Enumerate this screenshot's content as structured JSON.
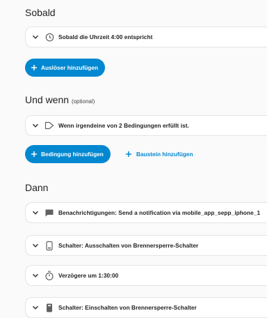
{
  "trigger": {
    "title": "Sobald",
    "items": [
      {
        "icon": "clock-icon",
        "label": "Sobald die Uhrzeit 4:00 entspricht"
      }
    ],
    "add_button": "Auslöser hinzufügen"
  },
  "conditions": {
    "title": "Und wenn",
    "optional_label": "(optional)",
    "items": [
      {
        "icon": "condition-icon",
        "label": "Wenn irgendeine von 2 Bedingungen erfüllt ist."
      }
    ],
    "add_button": "Bedingung hinzufügen",
    "add_block_button": "Baustein hinzufügen"
  },
  "actions": {
    "title": "Dann",
    "items": [
      {
        "icon": "message-icon",
        "label": "Benachrichtigungen: Send a notification via mobile_app_sepp_iphone_1"
      },
      {
        "icon": "switch-icon",
        "label": "Schalter: Ausschalten von Brennersperre-Schalter"
      },
      {
        "icon": "timer-icon",
        "label": "Verzögere um 1:30:00"
      },
      {
        "icon": "switch-icon",
        "label": "Schalter: Einschalten von Brennersperre-Schalter"
      }
    ]
  },
  "colors": {
    "primary": "#0288d1",
    "background": "#fafafa",
    "card": "#ffffff"
  }
}
